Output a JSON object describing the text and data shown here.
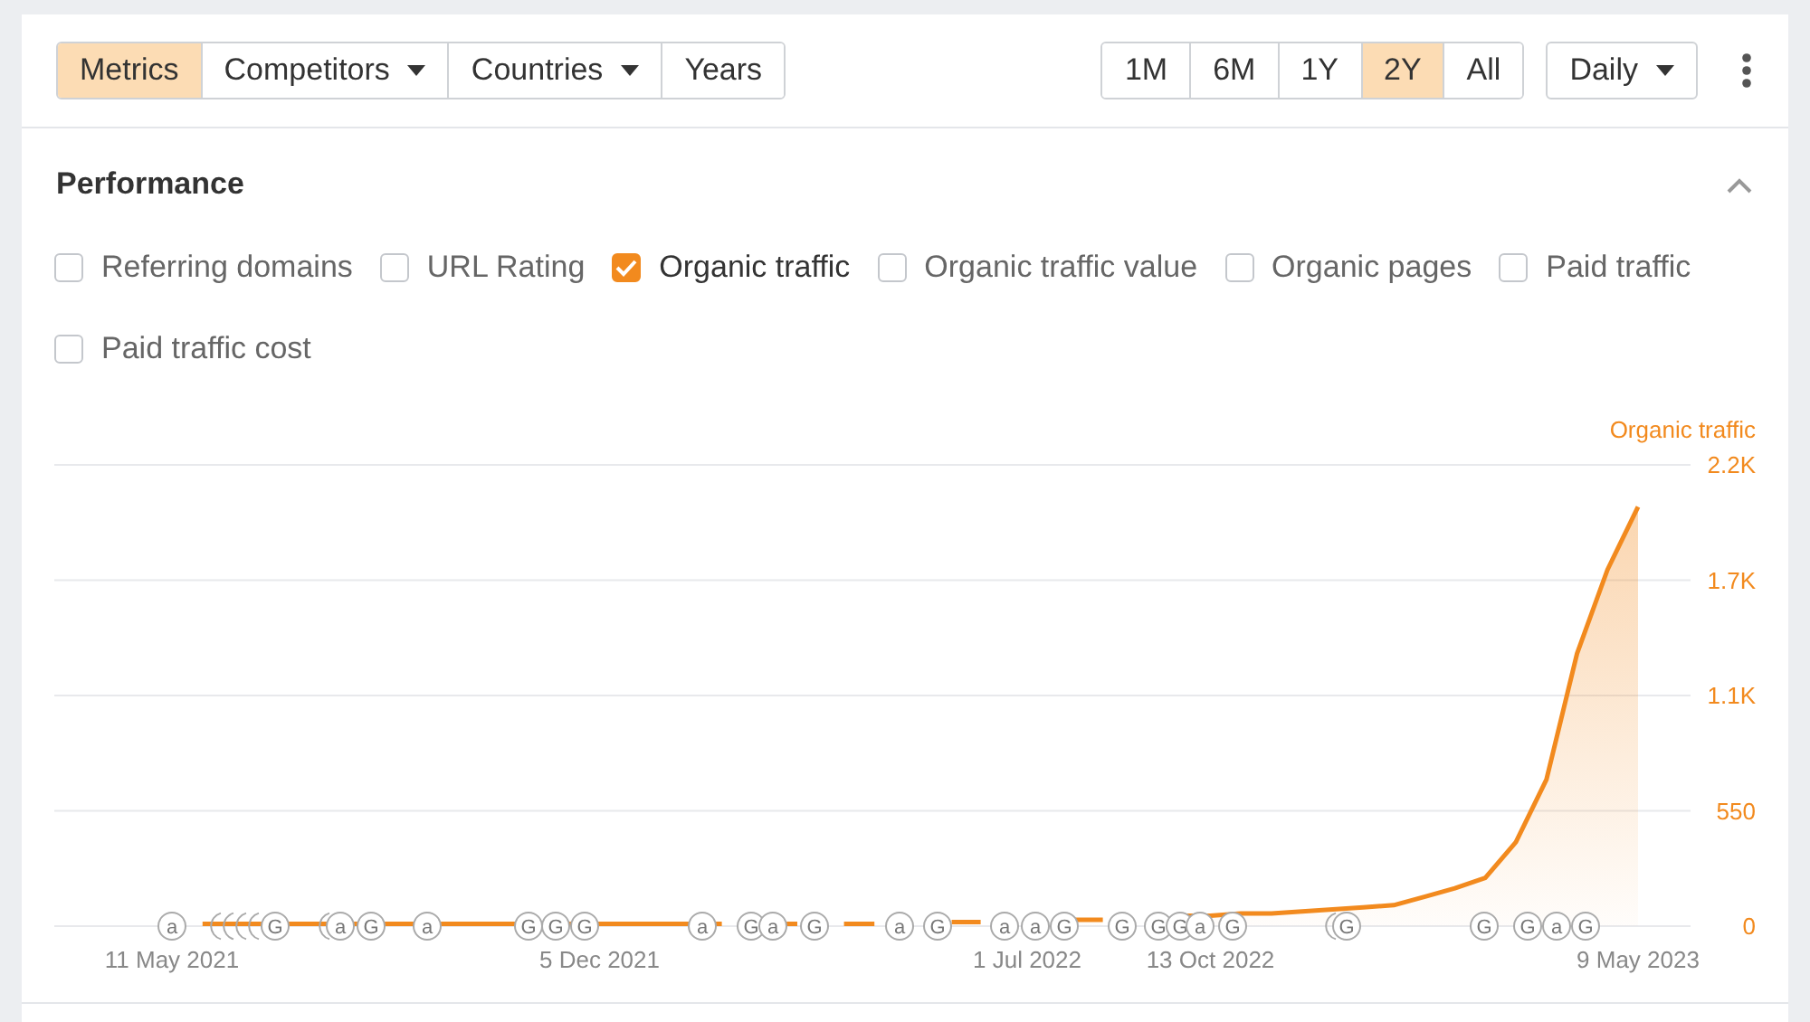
{
  "toolbar": {
    "views": [
      {
        "label": "Metrics",
        "selected": true,
        "dropdown": false
      },
      {
        "label": "Competitors",
        "selected": false,
        "dropdown": true
      },
      {
        "label": "Countries",
        "selected": false,
        "dropdown": true
      },
      {
        "label": "Years",
        "selected": false,
        "dropdown": false
      }
    ],
    "ranges": [
      {
        "label": "1M",
        "selected": false
      },
      {
        "label": "6M",
        "selected": false
      },
      {
        "label": "1Y",
        "selected": false
      },
      {
        "label": "2Y",
        "selected": true
      },
      {
        "label": "All",
        "selected": false
      }
    ],
    "interval": {
      "label": "Daily"
    }
  },
  "performance": {
    "title": "Performance",
    "expanded": true,
    "metrics": [
      {
        "label": "Referring domains",
        "checked": false
      },
      {
        "label": "URL Rating",
        "checked": false
      },
      {
        "label": "Organic traffic",
        "checked": true
      },
      {
        "label": "Organic traffic value",
        "checked": false
      },
      {
        "label": "Organic pages",
        "checked": false
      },
      {
        "label": "Paid traffic",
        "checked": false
      },
      {
        "label": "Paid traffic cost",
        "checked": false
      }
    ],
    "chart_data": {
      "type": "area",
      "grid": true,
      "ylim": [
        0,
        2200
      ],
      "categories": [
        "11 May 2021",
        null,
        null,
        null,
        null,
        null,
        null,
        null,
        null,
        null,
        null,
        null,
        null,
        null,
        "5 Dec 2021",
        null,
        null,
        null,
        null,
        null,
        null,
        null,
        null,
        null,
        null,
        null,
        null,
        null,
        "1 Jul 2022",
        null,
        null,
        null,
        null,
        null,
        "13 Oct 2022",
        null,
        null,
        null,
        null,
        null,
        null,
        null,
        null,
        null,
        null,
        null,
        null,
        null,
        "9 May 2023"
      ],
      "yticks": [
        {
          "value": 0,
          "label": "0"
        },
        {
          "value": 550,
          "label": "550"
        },
        {
          "value": 1100,
          "label": "1.1K"
        },
        {
          "value": 1650,
          "label": "1.7K"
        },
        {
          "value": 2200,
          "label": "2.2K"
        }
      ],
      "series": [
        {
          "name": "Organic traffic",
          "color": "#f28a1e",
          "values": [
            null,
            10,
            10,
            10,
            10,
            10,
            10,
            10,
            10,
            10,
            10,
            10,
            10,
            10,
            10,
            10,
            10,
            10,
            10,
            null,
            10,
            null,
            10,
            10,
            null,
            null,
            20,
            null,
            null,
            null,
            30,
            null,
            null,
            50,
            50,
            60,
            60,
            70,
            80,
            90,
            100,
            140,
            180,
            230,
            400,
            700,
            1300,
            1700,
            2000
          ]
        }
      ]
    },
    "events": [
      {
        "text": "a",
        "covered": false
      },
      {
        "covered": true
      },
      {
        "covered": true
      },
      {
        "covered": true
      },
      {
        "covered": true
      },
      {
        "text": "G",
        "covered": false
      },
      {
        "covered": true
      },
      {
        "text": "a",
        "covered": false
      },
      {
        "text": "G",
        "covered": false
      },
      {
        "text": "a",
        "covered": false
      },
      {
        "text": "G",
        "covered": false
      },
      {
        "text": "G",
        "covered": false
      },
      {
        "text": "G",
        "covered": false
      },
      {
        "text": "a",
        "covered": false
      },
      {
        "text": "G",
        "covered": false
      },
      {
        "text": "a",
        "covered": false
      },
      {
        "text": "G",
        "covered": false
      },
      {
        "text": "a",
        "covered": false
      },
      {
        "text": "G",
        "covered": false
      },
      {
        "text": "a",
        "covered": false
      },
      {
        "text": "a",
        "covered": false
      },
      {
        "text": "G",
        "covered": false
      },
      {
        "text": "G",
        "covered": false
      },
      {
        "text": "G",
        "covered": false
      },
      {
        "text": "G",
        "covered": false
      },
      {
        "text": "a",
        "covered": false
      },
      {
        "text": "G",
        "covered": false
      },
      {
        "covered": true
      },
      {
        "text": "G",
        "covered": false
      },
      {
        "text": "G",
        "covered": false
      },
      {
        "text": "G",
        "covered": false
      },
      {
        "text": "a",
        "covered": false
      },
      {
        "text": "G",
        "covered": false
      }
    ]
  }
}
